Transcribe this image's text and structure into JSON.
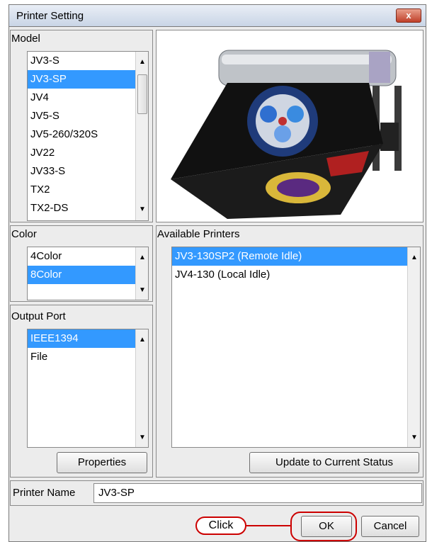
{
  "window": {
    "title": "Printer Setting",
    "close_glyph": "x"
  },
  "model": {
    "label": "Model",
    "items": [
      "JV3-S",
      "JV3-SP",
      "JV4",
      "JV5-S",
      "JV5-260/320S",
      "JV22",
      "JV33-S",
      "TX2",
      "TX2-DS"
    ],
    "selected_index": 1
  },
  "preview": {
    "icon": "printer-photo"
  },
  "color": {
    "label": "Color",
    "items": [
      "4Color",
      "8Color"
    ],
    "selected_index": 1
  },
  "output_port": {
    "label": "Output Port",
    "items": [
      "IEEE1394",
      "File"
    ],
    "selected_index": 0,
    "properties_label": "Properties"
  },
  "available_printers": {
    "label": "Available Printers",
    "items": [
      "JV3-130SP2 (Remote Idle)",
      "JV4-130 (Local Idle)"
    ],
    "selected_index": 0,
    "update_label": "Update to Current Status"
  },
  "printer_name": {
    "label": "Printer Name",
    "value": "JV3-SP"
  },
  "buttons": {
    "ok_label": "OK",
    "cancel_label": "Cancel"
  },
  "annotation": {
    "click_label": "Click",
    "color": "#cc0000"
  },
  "colors": {
    "selection": "#3399ff",
    "dialog_bg": "#ececec"
  }
}
